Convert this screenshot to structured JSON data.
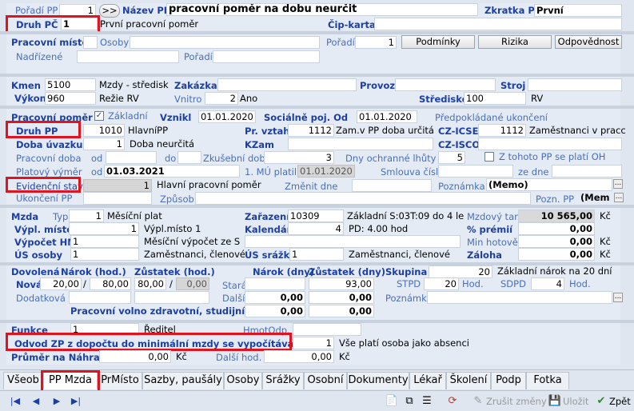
{
  "top": {
    "poradi_pp_label": "Pořadí PP",
    "poradi_pp_value": "1",
    "goto_btn": ">>",
    "nazev_pp_label": "Název PP",
    "nazev_pp_value": "pracovní poměr na dobu neurčit",
    "zkratka_pp_label": "Zkratka PP",
    "zkratka_pp_value": "První",
    "druh_pc_label": "Druh PČ",
    "druh_pc_value": "1",
    "druh_pc_text": "První pracovní poměr",
    "cip_karta_label": "Čip-karta"
  },
  "pm": {
    "label": "Pracovní místo",
    "osoby_label": "Osoby",
    "poradi_label": "Pořadí",
    "poradi_value": "1",
    "nadrizene_label": "Nadřízené",
    "poradi2_label": "Pořadí",
    "btn_podminky": "Podmínky",
    "btn_rizika": "Rizika",
    "btn_odpovednost": "Odpovědnost"
  },
  "kmen": {
    "kmen_label": "Kmen",
    "kmen_value": "5100",
    "kmen_text": "Mzdy - středisk",
    "zakazka_label": "Zakázka",
    "provoz_label": "Provoz",
    "stroj_label": "Stroj",
    "vykon_label": "Výkon",
    "vykon_value": "960",
    "vykon_text": "Režie RV",
    "vnitro_label": "Vnitro",
    "vnitro_value": "2",
    "vnitro_text": "Ano",
    "stredisko_label": "Středisko",
    "stredisko_value": "100",
    "stredisko_text": "RV"
  },
  "pp": {
    "pracovni_pomer_label": "Pracovní poměr",
    "zakladni_label": "Základní",
    "zakladni_checked": "✓",
    "vznikl_label": "Vznikl",
    "vznikl_value": "01.01.2020",
    "socialne_label": "Sociálně poj. Od",
    "socialne_value": "01.01.2020",
    "predpokladane_label": "Předpokládané ukončení",
    "druh_pp_label": "Druh PP",
    "druh_pp_value": "1010",
    "druh_pp_text": "HlavníPP",
    "pr_vztah_label": "Pr. vztah",
    "pr_vztah_value": "1112",
    "pr_vztah_text": "Zam.v PP doba určitá",
    "cz_icse_label": "CZ-ICSE",
    "cz_icse_value": "1112",
    "cz_icse_text": "Zaměstnanci v pracc",
    "doba_uvazku_label": "Doba úvazku",
    "doba_uvazku_value": "1",
    "doba_uvazku_text": "Doba neurčitá",
    "kzam_label": "KZam",
    "cz_isco_label": "CZ-ISCO",
    "pracovni_doba_label": "Pracovní doba",
    "od_label": "od",
    "do_label": "do",
    "zkusebni_label": "Zkušební doba",
    "zkusebni_value": "3",
    "dny_ochranne_label": "Dny ochranné lhůty",
    "dny_ochranne_value": "5",
    "z_tohoto_label": "Z tohoto PP se platí OH",
    "platovy_label": "Platový výměr",
    "platovy_od_label": "od",
    "platovy_value": "01.03.2021",
    "mu_platil_label": "1. MÚ platil od",
    "mu_platil_value": "01.01.2020",
    "smlouva_label": "Smlouva číslo",
    "ze_dne_label": "ze dne",
    "evidencni_label": "Evidenční stav",
    "evidencni_value": "1",
    "evidencni_text": "Hlavní pracovní poměr",
    "zmenit_label": "Změnit dne",
    "poznamka_label": "Poznámka",
    "poznamka_value": "(Memo)",
    "ukonceni_label": "Ukončení PP",
    "zpusob_label": "Způsob",
    "pozn_pp_label": "Pozn. PP",
    "pozn_pp_value": "(Mem"
  },
  "mzda": {
    "mzda_label": "Mzda",
    "typ_label": "Typ",
    "typ_value": "1",
    "typ_text": "Měsíční plat",
    "zarazeni_label": "Zařazení",
    "zarazeni_value": "10309",
    "zarazeni_text": "Základní S:03T:09 do 4 le",
    "tarif_label": "Mzdový tarif",
    "tarif_value": "10 565,00",
    "tarif_unit": "Kč",
    "vypl_misto_label": "Výpl. místo",
    "vypl_misto_value": "1",
    "vypl_misto_text": "Výpl.místo 1",
    "kalendar_label": "Kalendář",
    "kalendar_value": "4",
    "kalendar_text": "PD: 4.00 hod",
    "premii_label": "% prémií",
    "premii_value": "0,00",
    "vypocet_label": "Výpočet HM",
    "vypocet_value": "1",
    "vypocet_text": "Měsíční výpočet ze S",
    "min_hotove_label": "Min hotově",
    "min_hotove_value": "0,00",
    "min_hotove_unit": "Kč",
    "us_osoby_label": "ÚS osoby",
    "us_osoby_value": "1",
    "us_osoby_text": "Zaměstnanci, členové",
    "us_srazky_label": "ÚS srážky",
    "us_srazky_value": "1",
    "us_srazky_text": "Zaměstnanci, členové",
    "zaloha_label": "Záloha",
    "zaloha_value": "0,00",
    "zaloha_unit": "Kč"
  },
  "dov": {
    "dovolena_label": "Dovolená",
    "narok_hod_label": "Nárok (hod.)",
    "zustatek_hod_label": "Zůstatek (hod.)",
    "narok_dny_label": "Nárok (dny)",
    "zustatek_dny_label": "Zůstatek (dny)",
    "skupina_label": "Skupina",
    "skupina_value": "20",
    "skupina_text": "Základní nárok na 20 dní",
    "nova_label": "Nová",
    "nova_narok_a": "20,00",
    "nova_slash": "/",
    "nova_narok_b": "80,00",
    "nova_zust_a": "80,00",
    "nova_slash2": "/",
    "nova_zust_b": "0,00",
    "stara_label": "Stará",
    "stara_zust_dny": "93,00",
    "stpd_label": "STPD",
    "stpd_value": "20",
    "stpd_unit": "Hod.",
    "sdpd_label": "SDPD",
    "sdpd_value": "4",
    "sdpd_unit": "Hod.",
    "dodatkova_label": "Dodatková",
    "dalsi_label": "Další",
    "dalsi_narok": "0,00",
    "dalsi_zust": "0,00",
    "poznamka_label": "Poznámka",
    "volno_label": "Pracovní volno zdravotní, studijní a jiné",
    "volno_narok": "0,00",
    "volno_zust": "0,00"
  },
  "foot": {
    "funkce_label": "Funkce",
    "funkce_value": "1",
    "funkce_text": "Ředitel",
    "hmot_label": "HmotOdp.",
    "odvod_label": "Odvod ZP z dopočtu do minimální mzdy se  vypočítává jako",
    "odvod_value": "1",
    "odvod_text": "Vše platí osoba jako absenci",
    "prumer_label": "Průměr na Náhrady",
    "prumer_value": "0,00",
    "prumer_unit": "Kč",
    "dalsi_hod_label": "Další hod.",
    "dalsi_hod_value": "0,00",
    "dalsi_hod_unit": "Kč"
  },
  "tabs": [
    "Všeob",
    "PP Mzda",
    "PrMísto",
    "Sazby, paušály",
    "Osoby",
    "Srážky",
    "Osobní",
    "Dokumenty",
    "Lékař",
    "Školení",
    "Podp",
    "Fotka"
  ],
  "toolbar": {
    "zrusit": "Zrušit změny",
    "ulozit": "Uložit",
    "zpet": "Zpět"
  },
  "icons": {
    "nav_first": "first-record-icon",
    "nav_prev": "prev-record-icon",
    "nav_next": "next-record-icon",
    "nav_last": "last-record-icon",
    "new": "new-document-icon",
    "refresh": "refresh-icon",
    "cancel": "cancel-icon",
    "save": "save-icon",
    "back": "back-icon"
  }
}
